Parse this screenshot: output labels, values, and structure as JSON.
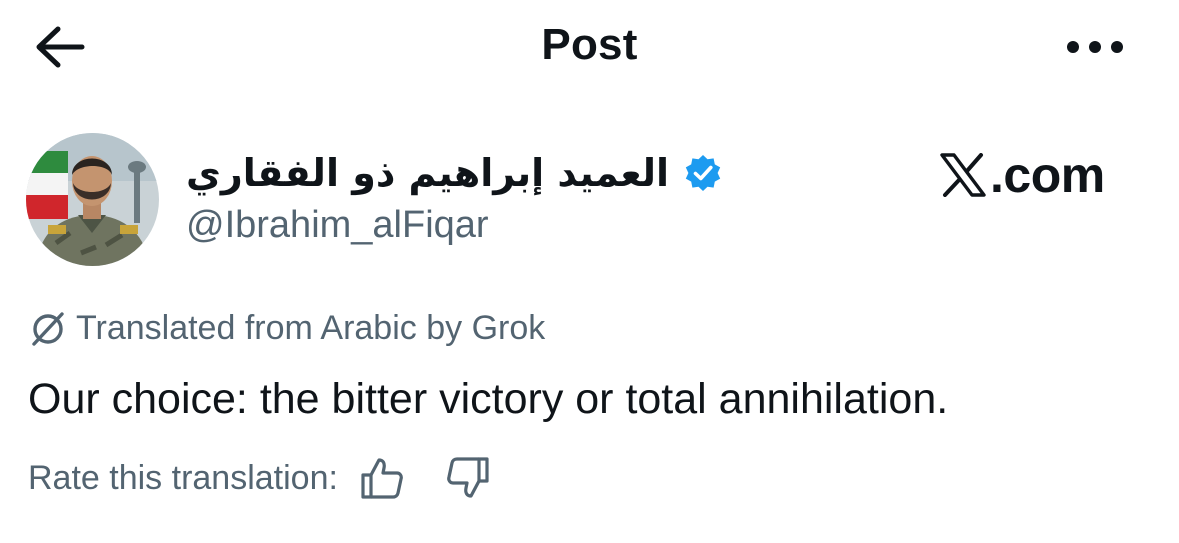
{
  "header": {
    "title": "Post",
    "back_icon": "arrow-left-icon",
    "more_icon": "more-horizontal-icon"
  },
  "author": {
    "display_name": "العميد إبراهيم ذو الفقاري",
    "handle": "@Ibrahim_alFiqar",
    "verified": true,
    "verified_color": "#1d9bf0"
  },
  "watermark": {
    "text": ".com"
  },
  "translation": {
    "notice": "Translated from Arabic by Grok",
    "icon": "grok-icon"
  },
  "post": {
    "text": "Our choice: the bitter victory or total annihilation."
  },
  "rating": {
    "label": "Rate this translation:",
    "thumbs_up_icon": "thumbs-up-icon",
    "thumbs_down_icon": "thumbs-down-icon"
  },
  "colors": {
    "text_primary": "#0f1419",
    "text_secondary": "#536471",
    "accent": "#1d9bf0"
  }
}
